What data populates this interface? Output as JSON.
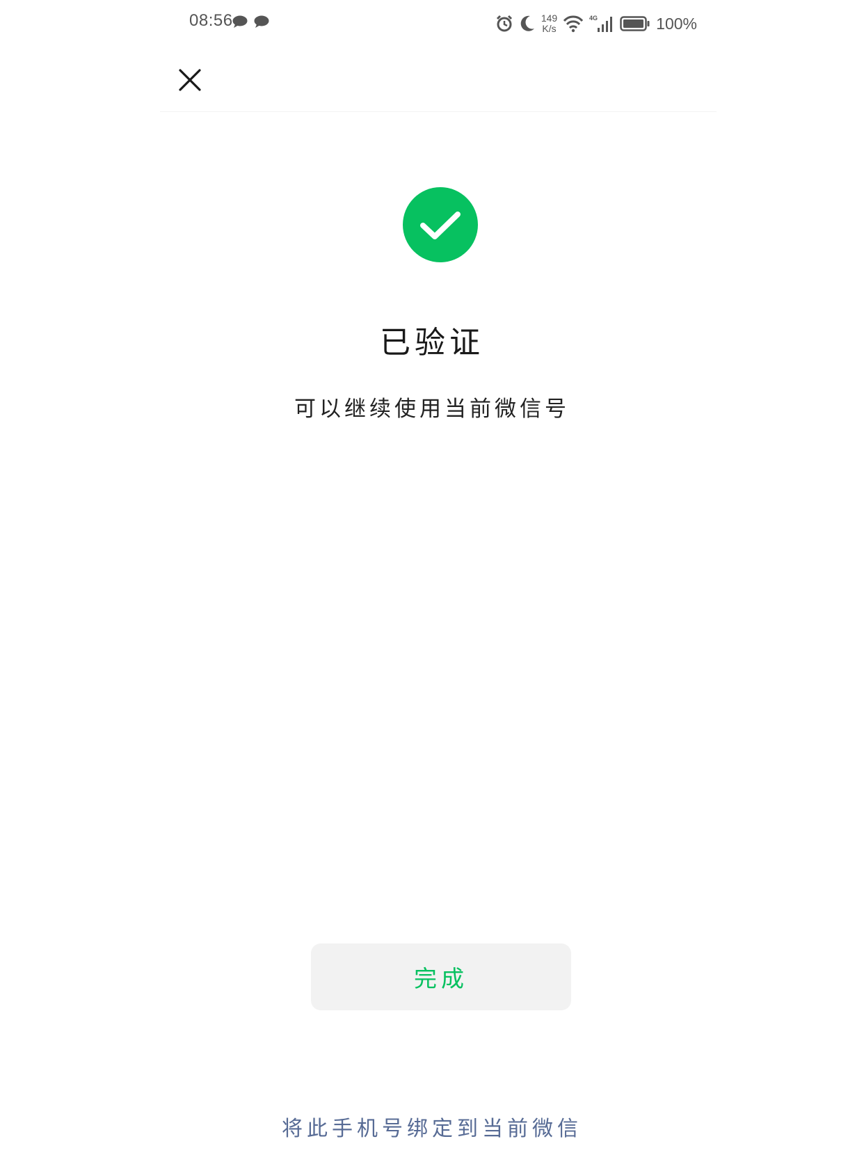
{
  "status_bar": {
    "time": "08:56",
    "net_speed_value": "149",
    "net_speed_unit": "K/s",
    "network_type": "4G",
    "battery": "100%",
    "icons": [
      "chat-bubble-icon",
      "chat-bubble-icon",
      "alarm-icon",
      "moon-icon",
      "wifi-icon",
      "signal-icon",
      "battery-icon"
    ]
  },
  "nav": {
    "close_icon": "close-icon"
  },
  "result": {
    "icon": "success-check-icon",
    "icon_color": "#07c160",
    "title": "已验证",
    "subtitle": "可以继续使用当前微信号"
  },
  "actions": {
    "done_label": "完成",
    "bind_link": "将此手机号绑定到当前微信"
  },
  "colors": {
    "accent_green": "#07c160",
    "link_blue": "#576b95",
    "button_bg": "#f2f2f2"
  }
}
